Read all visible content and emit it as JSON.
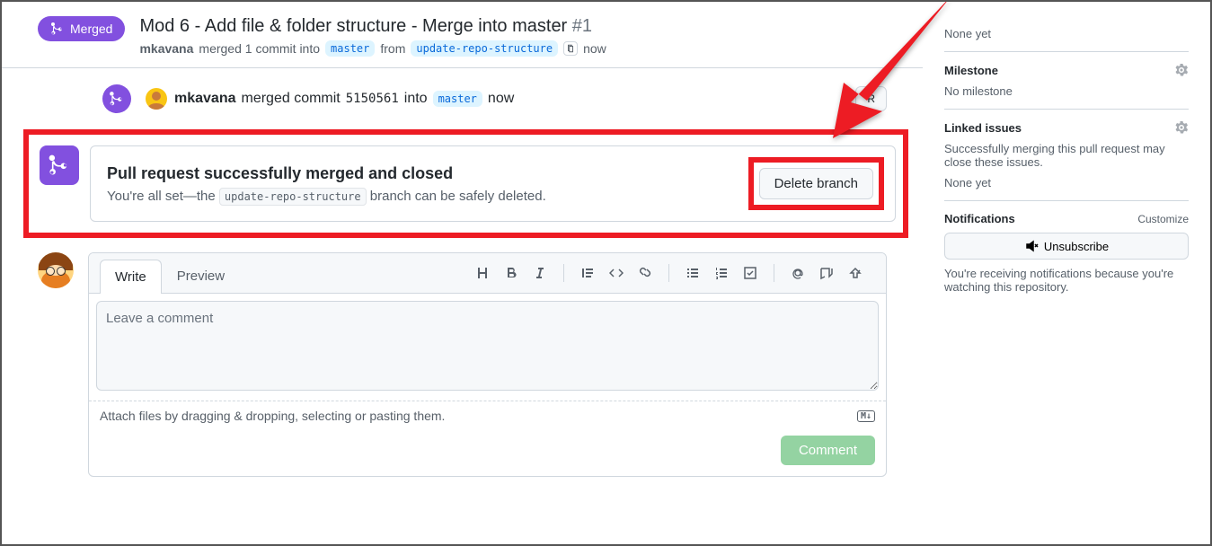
{
  "header": {
    "state": "Merged",
    "title": "Mod 6 - Add file & folder structure - Merge into master",
    "number": "#1",
    "author": "mkavana",
    "sub_merged": "merged 1 commit into",
    "base_branch": "master",
    "sub_from": "from",
    "head_branch": "update-repo-structure",
    "time": "now"
  },
  "timeline": {
    "author": "mkavana",
    "action": "merged commit",
    "commit": "5150561",
    "into": "into",
    "target_branch": "master",
    "when": "now",
    "revert_btn": "R"
  },
  "success": {
    "heading": "Pull request successfully merged and closed",
    "desc_pre": "You're all set—the ",
    "branch": "update-repo-structure",
    "desc_post": " branch can be safely deleted.",
    "delete_btn": "Delete branch"
  },
  "comment": {
    "tab_write": "Write",
    "tab_preview": "Preview",
    "placeholder": "Leave a comment",
    "attach_hint": "Attach files by dragging & dropping, selecting or pasting them.",
    "md_badge": "M↓",
    "submit": "Comment"
  },
  "sidebar": {
    "none_yet": "None yet",
    "milestone_label": "Milestone",
    "no_milestone": "No milestone",
    "linked_label": "Linked issues",
    "linked_desc": "Successfully merging this pull request may close these issues.",
    "linked_none": "None yet",
    "notif_label": "Notifications",
    "customize": "Customize",
    "unsubscribe": "Unsubscribe",
    "notif_desc": "You're receiving notifications because you're watching this repository."
  }
}
